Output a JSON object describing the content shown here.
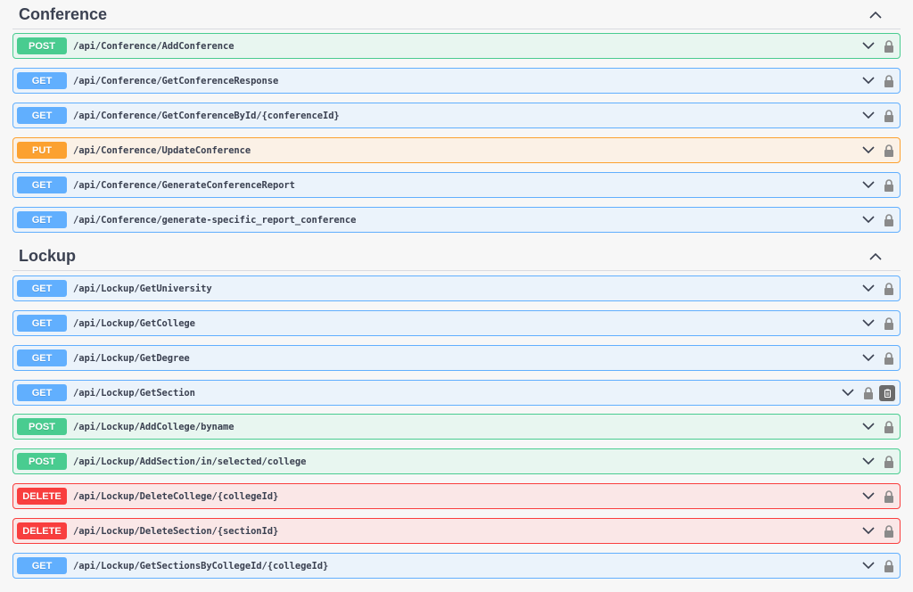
{
  "sections": [
    {
      "title": "Conference",
      "operations": [
        {
          "method": "POST",
          "path": "/api/Conference/AddConference"
        },
        {
          "method": "GET",
          "path": "/api/Conference/GetConferenceResponse"
        },
        {
          "method": "GET",
          "path": "/api/Conference/GetConferenceById/{conferenceId}"
        },
        {
          "method": "PUT",
          "path": "/api/Conference/UpdateConference"
        },
        {
          "method": "GET",
          "path": "/api/Conference/GenerateConferenceReport"
        },
        {
          "method": "GET",
          "path": "/api/Conference/generate-specific_report_conference"
        }
      ]
    },
    {
      "title": "Lockup",
      "operations": [
        {
          "method": "GET",
          "path": "/api/Lockup/GetUniversity"
        },
        {
          "method": "GET",
          "path": "/api/Lockup/GetCollege"
        },
        {
          "method": "GET",
          "path": "/api/Lockup/GetDegree"
        },
        {
          "method": "GET",
          "path": "/api/Lockup/GetSection"
        },
        {
          "method": "POST",
          "path": "/api/Lockup/AddCollege/byname"
        },
        {
          "method": "POST",
          "path": "/api/Lockup/AddSection/in/selected/college"
        },
        {
          "method": "DELETE",
          "path": "/api/Lockup/DeleteCollege/{collegeId}"
        },
        {
          "method": "DELETE",
          "path": "/api/Lockup/DeleteSection/{sectionId}"
        },
        {
          "method": "GET",
          "path": "/api/Lockup/GetSectionsByCollegeId/{collegeId}"
        }
      ]
    }
  ],
  "icons": {
    "section_toggle": "chevron-up-icon",
    "expand": "chevron-down-icon",
    "auth": "lock-icon",
    "copy": "copy-to-clipboard-icon"
  },
  "colors": {
    "get": "#61affe",
    "post": "#49cc90",
    "put": "#fca130",
    "delete": "#f93e3e"
  }
}
